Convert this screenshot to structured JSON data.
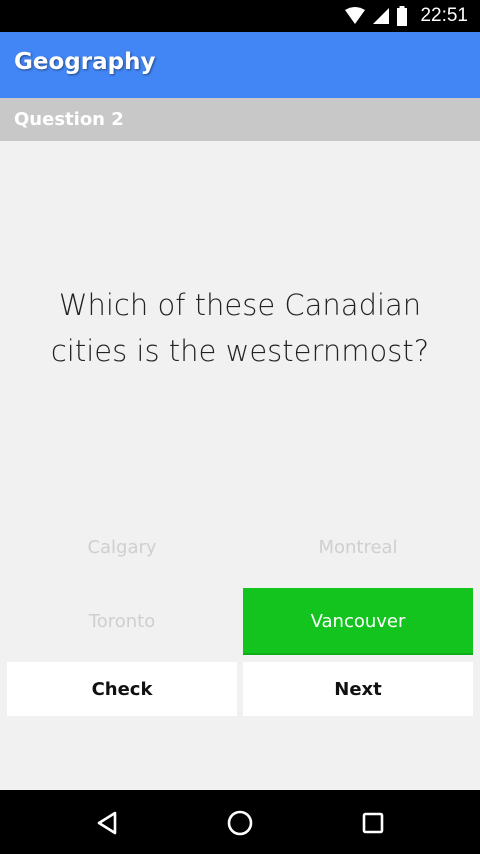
{
  "status_bar": {
    "time": "22:51",
    "icons": [
      "wifi-icon",
      "cell-signal-icon",
      "battery-icon"
    ]
  },
  "app_bar": {
    "title": "Geography",
    "color": "#4285f4"
  },
  "subheader": {
    "label": "Question 2"
  },
  "question": {
    "line1": "Which of these Canadian",
    "line2": "cities is the westernmost?"
  },
  "answers": [
    {
      "label": "Calgary",
      "selected": false
    },
    {
      "label": "Montreal",
      "selected": false
    },
    {
      "label": "Toronto",
      "selected": false
    },
    {
      "label": "Vancouver",
      "selected": true
    }
  ],
  "selected_color": "#12c41d",
  "buttons": {
    "check": "Check",
    "next": "Next"
  },
  "nav_bar": {
    "icons": [
      "back-icon",
      "home-icon",
      "recents-icon"
    ]
  }
}
